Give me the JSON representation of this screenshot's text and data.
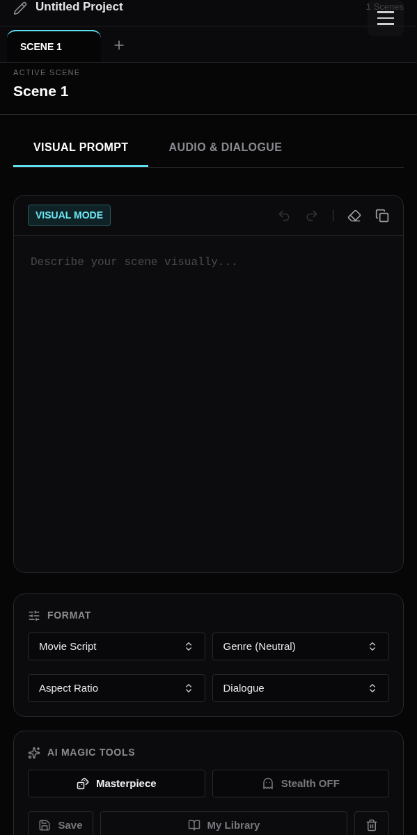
{
  "header": {
    "title": "Untitled Project",
    "scene_count": "1 Scenes"
  },
  "scene_tabs": [
    {
      "label": "SCENE 1",
      "selected": true
    }
  ],
  "active_scene": {
    "caption": "ACTIVE SCENE",
    "name": "Scene 1"
  },
  "mode_tabs": [
    {
      "label": "VISUAL PROMPT",
      "selected": true
    },
    {
      "label": "AUDIO & DIALOGUE",
      "selected": false
    }
  ],
  "editor": {
    "badge": "VISUAL MODE",
    "placeholder": "Describe your scene visually...",
    "undo_disabled": true,
    "redo_disabled": true
  },
  "format": {
    "title": "FORMAT",
    "selects": [
      "Movie Script",
      "Genre (Neutral)",
      "Aspect Ratio",
      "Dialogue"
    ]
  },
  "ai_tools": {
    "title": "AI MAGIC TOOLS",
    "masterpiece": "Masterpiece",
    "stealth": {
      "label": "Stealth OFF",
      "on": false
    },
    "save": {
      "label": "Save",
      "disabled": true
    },
    "library": {
      "label": "My Library",
      "disabled": true
    }
  }
}
